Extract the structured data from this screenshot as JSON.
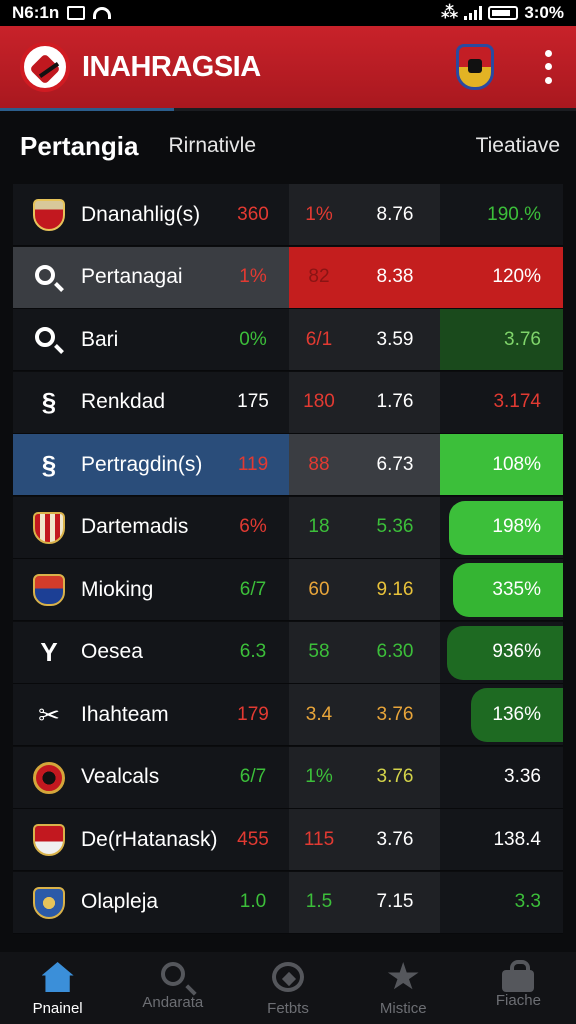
{
  "status_bar": {
    "time": "N6:1n",
    "battery": "3:0%"
  },
  "app_bar": {
    "title": "INAHRAGSIA"
  },
  "section": {
    "title": "Pertangia",
    "col_a": "Rirnativle",
    "col_b": "Tieatiave"
  },
  "colors": {
    "app_bar_red": "#c8222a",
    "positive_green": "#3cbf3a",
    "negative_red": "#e23a32",
    "selected_blue": "#2a4d7a",
    "nav_active": "#3b8fd9"
  },
  "rows": [
    {
      "icon": "club-crest-icon",
      "name": "Dnanahlig(s)",
      "v1": "360",
      "v2": "1%",
      "v3": "8.76",
      "v4": "190.%"
    },
    {
      "icon": "search-icon",
      "name": "Pertanagai",
      "v1": "1%",
      "v2": "82",
      "v3": "8.38",
      "v4": "120%"
    },
    {
      "icon": "search-icon",
      "name": "Bari",
      "v1": "0%",
      "v2": "6/1",
      "v3": "3.59",
      "v4": "3.76"
    },
    {
      "icon": "link-icon",
      "name": "Renkdad",
      "v1": "175",
      "v2": "180",
      "v3": "1.76",
      "v4": "3.174"
    },
    {
      "icon": "link-icon",
      "name": "Pertragdin(s)",
      "v1": "119",
      "v2": "88",
      "v3": "6.73",
      "v4": "108%"
    },
    {
      "icon": "club-crest-icon",
      "name": "Dartemadis",
      "v1": "6%",
      "v2": "18",
      "v3": "5.36",
      "v4": "198%"
    },
    {
      "icon": "club-crest-icon",
      "name": "Mioking",
      "v1": "6/7",
      "v2": "60",
      "v3": "9.16",
      "v4": "335%"
    },
    {
      "icon": "fork-icon",
      "name": "Oesea",
      "v1": "6.3",
      "v2": "58",
      "v3": "6.30",
      "v4": "936%"
    },
    {
      "icon": "scissors-icon",
      "name": "Ihahteam",
      "v1": "179",
      "v2": "3.4",
      "v3": "3.76",
      "v4": "136%"
    },
    {
      "icon": "club-crest-icon",
      "name": "Vealcals",
      "v1": "6/7",
      "v2": "1%",
      "v3": "3.76",
      "v4": "3.36"
    },
    {
      "icon": "club-crest-icon",
      "name": "De(rHatanask)",
      "v1": "455",
      "v2": "115",
      "v3": "3.76",
      "v4": "138.4"
    },
    {
      "icon": "club-crest-icon",
      "name": "Olapleja",
      "v1": "1.0",
      "v2": "1.5",
      "v3": "7.15",
      "v4": "3.3"
    }
  ],
  "bottom_nav": [
    {
      "label": "Pnainel",
      "icon": "home-icon"
    },
    {
      "label": "Andarata",
      "icon": "search-icon"
    },
    {
      "label": "Fetbts",
      "icon": "football-icon"
    },
    {
      "label": "Mistice",
      "icon": "star-icon"
    },
    {
      "label": "Fiache",
      "icon": "lock-icon"
    }
  ]
}
